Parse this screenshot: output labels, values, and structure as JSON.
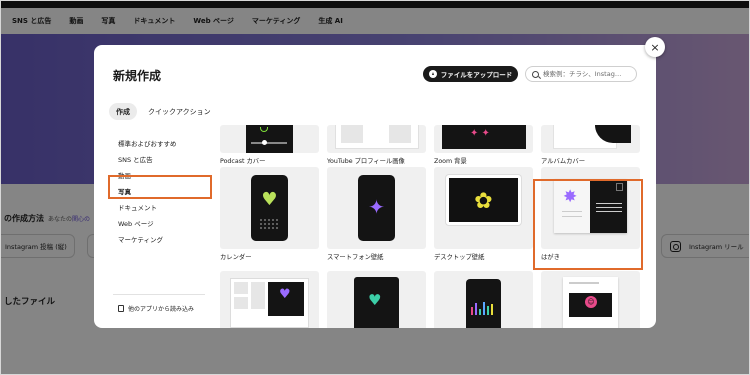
{
  "background": {
    "nav": [
      "SNS と広告",
      "動画",
      "写真",
      "ドキュメント",
      "Web ページ",
      "マーケティング",
      "生成 AI"
    ],
    "section_title": "の作成方法",
    "section_hint_prefix": "あなたの",
    "section_hint_link": "関心の",
    "pill_left": "Instagram 投稿 (縦)",
    "pill_right": "Instagram リール",
    "files_title": "したファイル"
  },
  "modal": {
    "title": "新規作成",
    "upload_label": "ファイルをアップロード",
    "search_placeholder": "検索例：チラシ、Instag…",
    "close_glyph": "×",
    "tabs": [
      {
        "label": "作成",
        "active": true
      },
      {
        "label": "クイックアクション",
        "active": false
      }
    ],
    "menu": [
      {
        "label": "標準およびおすすめ",
        "selected": false
      },
      {
        "label": "SNS と広告",
        "selected": false
      },
      {
        "label": "動画",
        "selected": false
      },
      {
        "label": "写真",
        "selected": true
      },
      {
        "label": "ドキュメント",
        "selected": false
      },
      {
        "label": "Web ページ",
        "selected": false
      },
      {
        "label": "マーケティング",
        "selected": false
      }
    ],
    "import_label": "他のアプリから読み込み",
    "row1": [
      "Podcast カバー",
      "YouTube プロフィール画像",
      "Zoom 背景",
      "アルバムカバー"
    ],
    "row2": [
      "カレンダー",
      "スマートフォン壁紙",
      "デスクトップ壁紙",
      "はがき"
    ],
    "highlight_color": "#e06a2b",
    "accent_colors": {
      "green": "#b9e15a",
      "purple": "#9a6bff",
      "yellow": "#e9df3c",
      "pink": "#e84a8a"
    }
  }
}
